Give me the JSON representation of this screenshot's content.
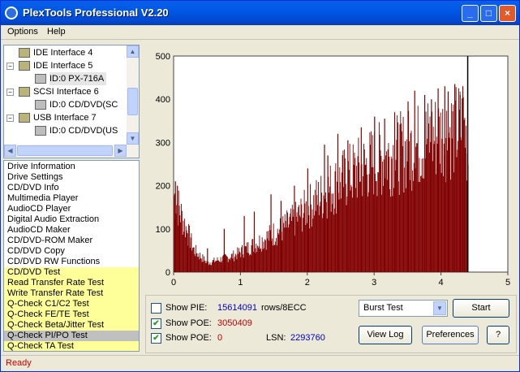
{
  "window": {
    "title": "PlexTools Professional V2.20",
    "minimize_glyph": "_",
    "maximize_glyph": "□",
    "close_glyph": "×"
  },
  "menu": [
    {
      "label": "Options",
      "underline": "O"
    },
    {
      "label": "Help",
      "underline": "H"
    }
  ],
  "tree": {
    "items": [
      {
        "label": "IDE Interface 4",
        "level": 1,
        "icon": "ide-interface-icon",
        "expander": ""
      },
      {
        "label": "IDE Interface 5",
        "level": 1,
        "icon": "ide-interface-icon",
        "expander": "−"
      },
      {
        "label": "ID:0  PX-716A",
        "level": 2,
        "icon": "optical-drive-icon",
        "expander": "",
        "selected": true
      },
      {
        "label": "SCSI Interface 6",
        "level": 1,
        "icon": "scsi-interface-icon",
        "expander": "−"
      },
      {
        "label": "ID:0  CD/DVD(SC",
        "level": 2,
        "icon": "optical-drive-icon",
        "expander": ""
      },
      {
        "label": "USB Interface 7",
        "level": 1,
        "icon": "usb-interface-icon",
        "expander": "−"
      },
      {
        "label": "ID:0  CD/DVD(US",
        "level": 2,
        "icon": "optical-drive-icon",
        "expander": ""
      }
    ],
    "scroll_left": "◀",
    "scroll_right": "▶",
    "scroll_up": "▲",
    "scroll_down": "▼"
  },
  "functions": [
    {
      "label": "Drive Information",
      "highlight": false
    },
    {
      "label": "Drive Settings",
      "highlight": false
    },
    {
      "label": "CD/DVD Info",
      "highlight": false
    },
    {
      "label": "Multimedia Player",
      "highlight": false
    },
    {
      "label": "AudioCD Player",
      "highlight": false
    },
    {
      "label": "Digital Audio Extraction",
      "highlight": false
    },
    {
      "label": "AudioCD Maker",
      "highlight": false
    },
    {
      "label": "CD/DVD-ROM Maker",
      "highlight": false
    },
    {
      "label": "CD/DVD Copy",
      "highlight": false
    },
    {
      "label": "CD/DVD RW Functions",
      "highlight": false
    },
    {
      "label": "CD/DVD Test",
      "highlight": true
    },
    {
      "label": "Read Transfer Rate Test",
      "highlight": true
    },
    {
      "label": "Write Transfer Rate Test",
      "highlight": true
    },
    {
      "label": "Q-Check C1/C2 Test",
      "highlight": true
    },
    {
      "label": "Q-Check FE/TE Test",
      "highlight": true
    },
    {
      "label": "Q-Check Beta/Jitter Test",
      "highlight": true
    },
    {
      "label": "Q-Check PI/PO Test",
      "highlight": true,
      "selected": true
    },
    {
      "label": "Q-Check TA Test",
      "highlight": true
    }
  ],
  "chart_data": {
    "type": "bar",
    "color": "#800000",
    "xlim": [
      0,
      5
    ],
    "ylim": [
      0,
      500
    ],
    "xticks": [
      "0",
      "1",
      "2",
      "3",
      "4",
      "5"
    ],
    "yticks": [
      "500",
      "400",
      "300",
      "200",
      "100",
      "0"
    ],
    "end_marker_x": 4.4,
    "envelope": [
      {
        "x": 0.0,
        "y": 210
      },
      {
        "x": 0.3,
        "y": 60
      },
      {
        "x": 0.5,
        "y": 25
      },
      {
        "x": 0.7,
        "y": 35
      },
      {
        "x": 0.9,
        "y": 45
      },
      {
        "x": 1.0,
        "y": 55
      },
      {
        "x": 1.2,
        "y": 75
      },
      {
        "x": 1.4,
        "y": 95
      },
      {
        "x": 1.6,
        "y": 115
      },
      {
        "x": 1.8,
        "y": 140
      },
      {
        "x": 2.0,
        "y": 175
      },
      {
        "x": 2.2,
        "y": 205
      },
      {
        "x": 2.4,
        "y": 235
      },
      {
        "x": 2.6,
        "y": 260
      },
      {
        "x": 2.8,
        "y": 280
      },
      {
        "x": 3.0,
        "y": 300
      },
      {
        "x": 3.2,
        "y": 315
      },
      {
        "x": 3.4,
        "y": 325
      },
      {
        "x": 3.6,
        "y": 340
      },
      {
        "x": 3.8,
        "y": 360
      },
      {
        "x": 4.0,
        "y": 375
      },
      {
        "x": 4.2,
        "y": 385
      },
      {
        "x": 4.35,
        "y": 395
      },
      {
        "x": 4.4,
        "y": 320
      }
    ],
    "spikes": [
      {
        "x": 0.02,
        "y": 210
      },
      {
        "x": 0.05,
        "y": 200
      },
      {
        "x": 0.08,
        "y": 110
      },
      {
        "x": 0.2,
        "y": 90
      },
      {
        "x": 0.25,
        "y": 80
      },
      {
        "x": 0.5,
        "y": 55
      },
      {
        "x": 0.75,
        "y": 100
      },
      {
        "x": 1.05,
        "y": 130
      },
      {
        "x": 1.2,
        "y": 140
      },
      {
        "x": 1.45,
        "y": 180
      },
      {
        "x": 1.6,
        "y": 165
      },
      {
        "x": 1.8,
        "y": 200
      },
      {
        "x": 2.0,
        "y": 240
      },
      {
        "x": 2.25,
        "y": 295
      },
      {
        "x": 2.3,
        "y": 270
      },
      {
        "x": 2.45,
        "y": 320
      },
      {
        "x": 2.6,
        "y": 305
      },
      {
        "x": 2.8,
        "y": 335
      },
      {
        "x": 3.0,
        "y": 360
      },
      {
        "x": 3.15,
        "y": 355
      },
      {
        "x": 3.3,
        "y": 370
      },
      {
        "x": 3.5,
        "y": 395
      },
      {
        "x": 3.6,
        "y": 420
      },
      {
        "x": 3.75,
        "y": 410
      },
      {
        "x": 3.85,
        "y": 400
      },
      {
        "x": 3.95,
        "y": 425
      },
      {
        "x": 4.05,
        "y": 430
      },
      {
        "x": 4.1,
        "y": 418
      },
      {
        "x": 4.2,
        "y": 435
      },
      {
        "x": 4.28,
        "y": 410
      },
      {
        "x": 4.32,
        "y": 430
      }
    ]
  },
  "controls": {
    "show_pie": {
      "label": "Show PIE:",
      "checked": false,
      "value": "15614091",
      "unit": "rows/8ECC",
      "value_color": "#0000c0"
    },
    "show_poe1": {
      "label": "Show POE:",
      "checked": true,
      "value": "3050409",
      "value_color": "#c00000"
    },
    "show_poe2": {
      "label": "Show POE:",
      "checked": true,
      "value": "0",
      "value_color": "#c00000"
    },
    "lsn_label": "LSN:",
    "lsn_value": "2293760",
    "lsn_color": "#0000c0",
    "test_select": "Burst Test",
    "select_arrow": "▼",
    "check_glyph": "✔",
    "start_label": "Start",
    "view_log_label": "View Log",
    "preferences_label": "Preferences",
    "help_label": "?"
  },
  "status": {
    "text": "Ready"
  }
}
